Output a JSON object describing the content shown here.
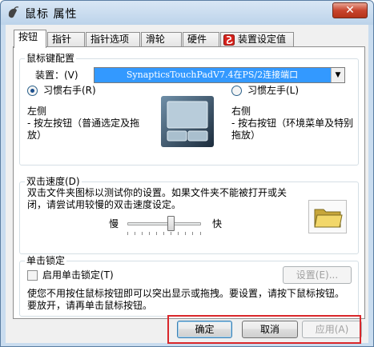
{
  "window": {
    "title": "鼠标 属性",
    "close_glyph": "✕"
  },
  "tabs": [
    {
      "label": "按钮",
      "active": true
    },
    {
      "label": "指针",
      "active": false
    },
    {
      "label": "指针选项",
      "active": false
    },
    {
      "label": "滑轮",
      "active": false
    },
    {
      "label": "硬件",
      "active": false
    },
    {
      "label": "装置设定值",
      "active": false
    }
  ],
  "button_config": {
    "legend": "鼠标键配置",
    "device_label": "装置：(V)",
    "device_value": "SynapticsTouchPadV7.4在PS/2连接端口",
    "right_hand_label": "习惯右手(R)",
    "right_hand_checked": true,
    "left_hand_label": "习惯左手(L)",
    "left_hand_checked": false,
    "left_side_title": "左侧",
    "left_side_desc": "- 按左按钮（普通选定及拖放）",
    "right_side_title": "右侧",
    "right_side_desc": "- 按右按钮（环境菜单及特别拖放）"
  },
  "double_click": {
    "legend": "双击速度(D)",
    "desc": "双击文件夹图标以测试你的设置。如果文件夹不能被打开或关闭，请尝试用较慢的双击速度设定。",
    "slow_label": "慢",
    "fast_label": "快",
    "speed_fraction": 0.6
  },
  "click_lock": {
    "legend": "单击锁定",
    "checkbox_label": "启用单击锁定(T)",
    "checked": false,
    "settings_button": "设置(E)...",
    "desc": "使您不用按住鼠标按钮即可以突出显示或拖拽。要设置，请按下鼠标按钮。要放开，请再单击鼠标按钮。"
  },
  "footer": {
    "ok": "确定",
    "cancel": "取消",
    "apply": "应用(A)"
  },
  "colors": {
    "accent": "#3399ff",
    "annotation": "#d9272b"
  },
  "icons": {
    "title": "mouse-icon",
    "device_tab": "synaptics-icon",
    "touchpad": "touchpad-image",
    "folder": "folder-icon"
  }
}
